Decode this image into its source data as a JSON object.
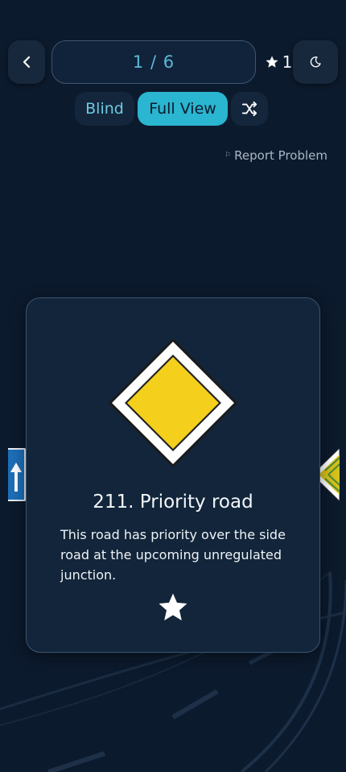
{
  "nav": {
    "back_icon": "chevron-left-icon",
    "counter": "1 / 6",
    "favorites_count": "1",
    "favorites_icon": "star-icon",
    "theme_icon": "moon-icon"
  },
  "modes": {
    "blind_label": "Blind",
    "full_view_label": "Full View",
    "shuffle_icon": "shuffle-icon",
    "active": "Full View"
  },
  "report": {
    "label": "Report Problem",
    "icon": "flag-icon"
  },
  "card": {
    "title": "211. Priority road",
    "description": "This road has priority over the side road at the upcoming unregulated junction.",
    "favorite_icon": "star-icon",
    "sign_icon": "priority-road-sign-icon"
  },
  "colors": {
    "background": "#0c1a2d",
    "card": "#12253a",
    "accent": "#2ab5d0",
    "sign_yellow": "#f4d01c"
  }
}
